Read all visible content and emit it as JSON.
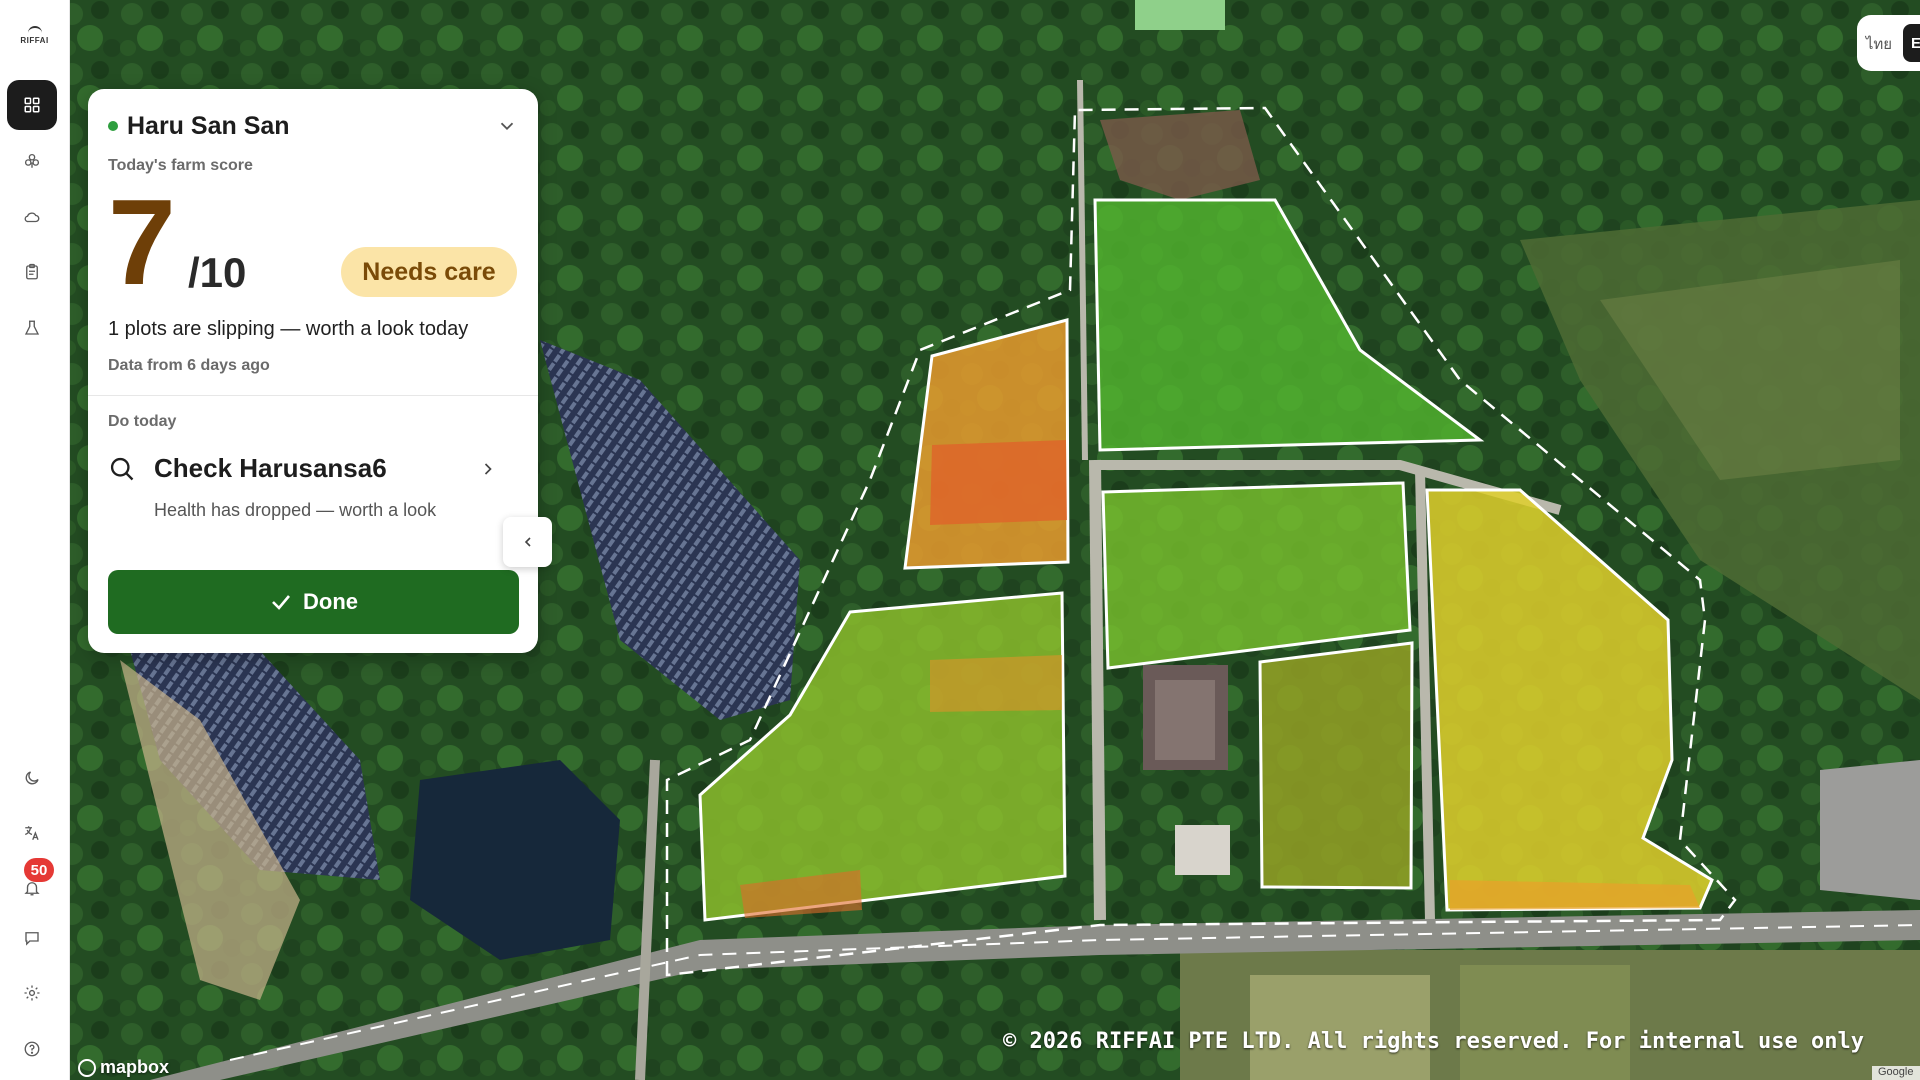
{
  "brand": {
    "logo_text": "RIFFAI"
  },
  "sidebar": {
    "items": [
      {
        "name": "dashboard",
        "icon": "grid-icon"
      },
      {
        "name": "plots",
        "icon": "clover-icon"
      },
      {
        "name": "weather",
        "icon": "cloud-icon"
      },
      {
        "name": "tasks",
        "icon": "clipboard-icon"
      },
      {
        "name": "harvest",
        "icon": "flask-icon"
      }
    ],
    "bottom_items": [
      {
        "name": "theme",
        "icon": "moon-icon"
      },
      {
        "name": "language",
        "icon": "translate-icon"
      },
      {
        "name": "notifications",
        "icon": "bell-icon"
      },
      {
        "name": "messages",
        "icon": "chat-icon"
      },
      {
        "name": "settings",
        "icon": "gear-icon"
      },
      {
        "name": "help",
        "icon": "help-icon"
      }
    ],
    "notification_count": "50"
  },
  "farm_card": {
    "farm_name": "Haru San San",
    "score_label": "Today's farm score",
    "score": "7",
    "score_max": "/10",
    "status_badge": "Needs care",
    "summary": "1 plots are slipping — worth a look today",
    "data_age": "Data from 6 days ago",
    "do_today_label": "Do today",
    "task_title": "Check Harusansa6",
    "task_description": "Health has dropped — worth a look",
    "done_label": "Done"
  },
  "language_toggle": {
    "thai": "ไทย",
    "english": "E"
  },
  "map": {
    "copyright": "© 2026 RIFFAI PTE LTD. All rights reserved. For internal use only",
    "attribution": "mapbox",
    "google_label": "Google"
  },
  "colors": {
    "primary": "#1f6b21",
    "status_ok": "#2e9e3e",
    "warning_badge_bg": "#fbe4a7",
    "warning_badge_text": "#7a4b08",
    "score_color": "#6e3f08",
    "alert": "#e53935"
  }
}
